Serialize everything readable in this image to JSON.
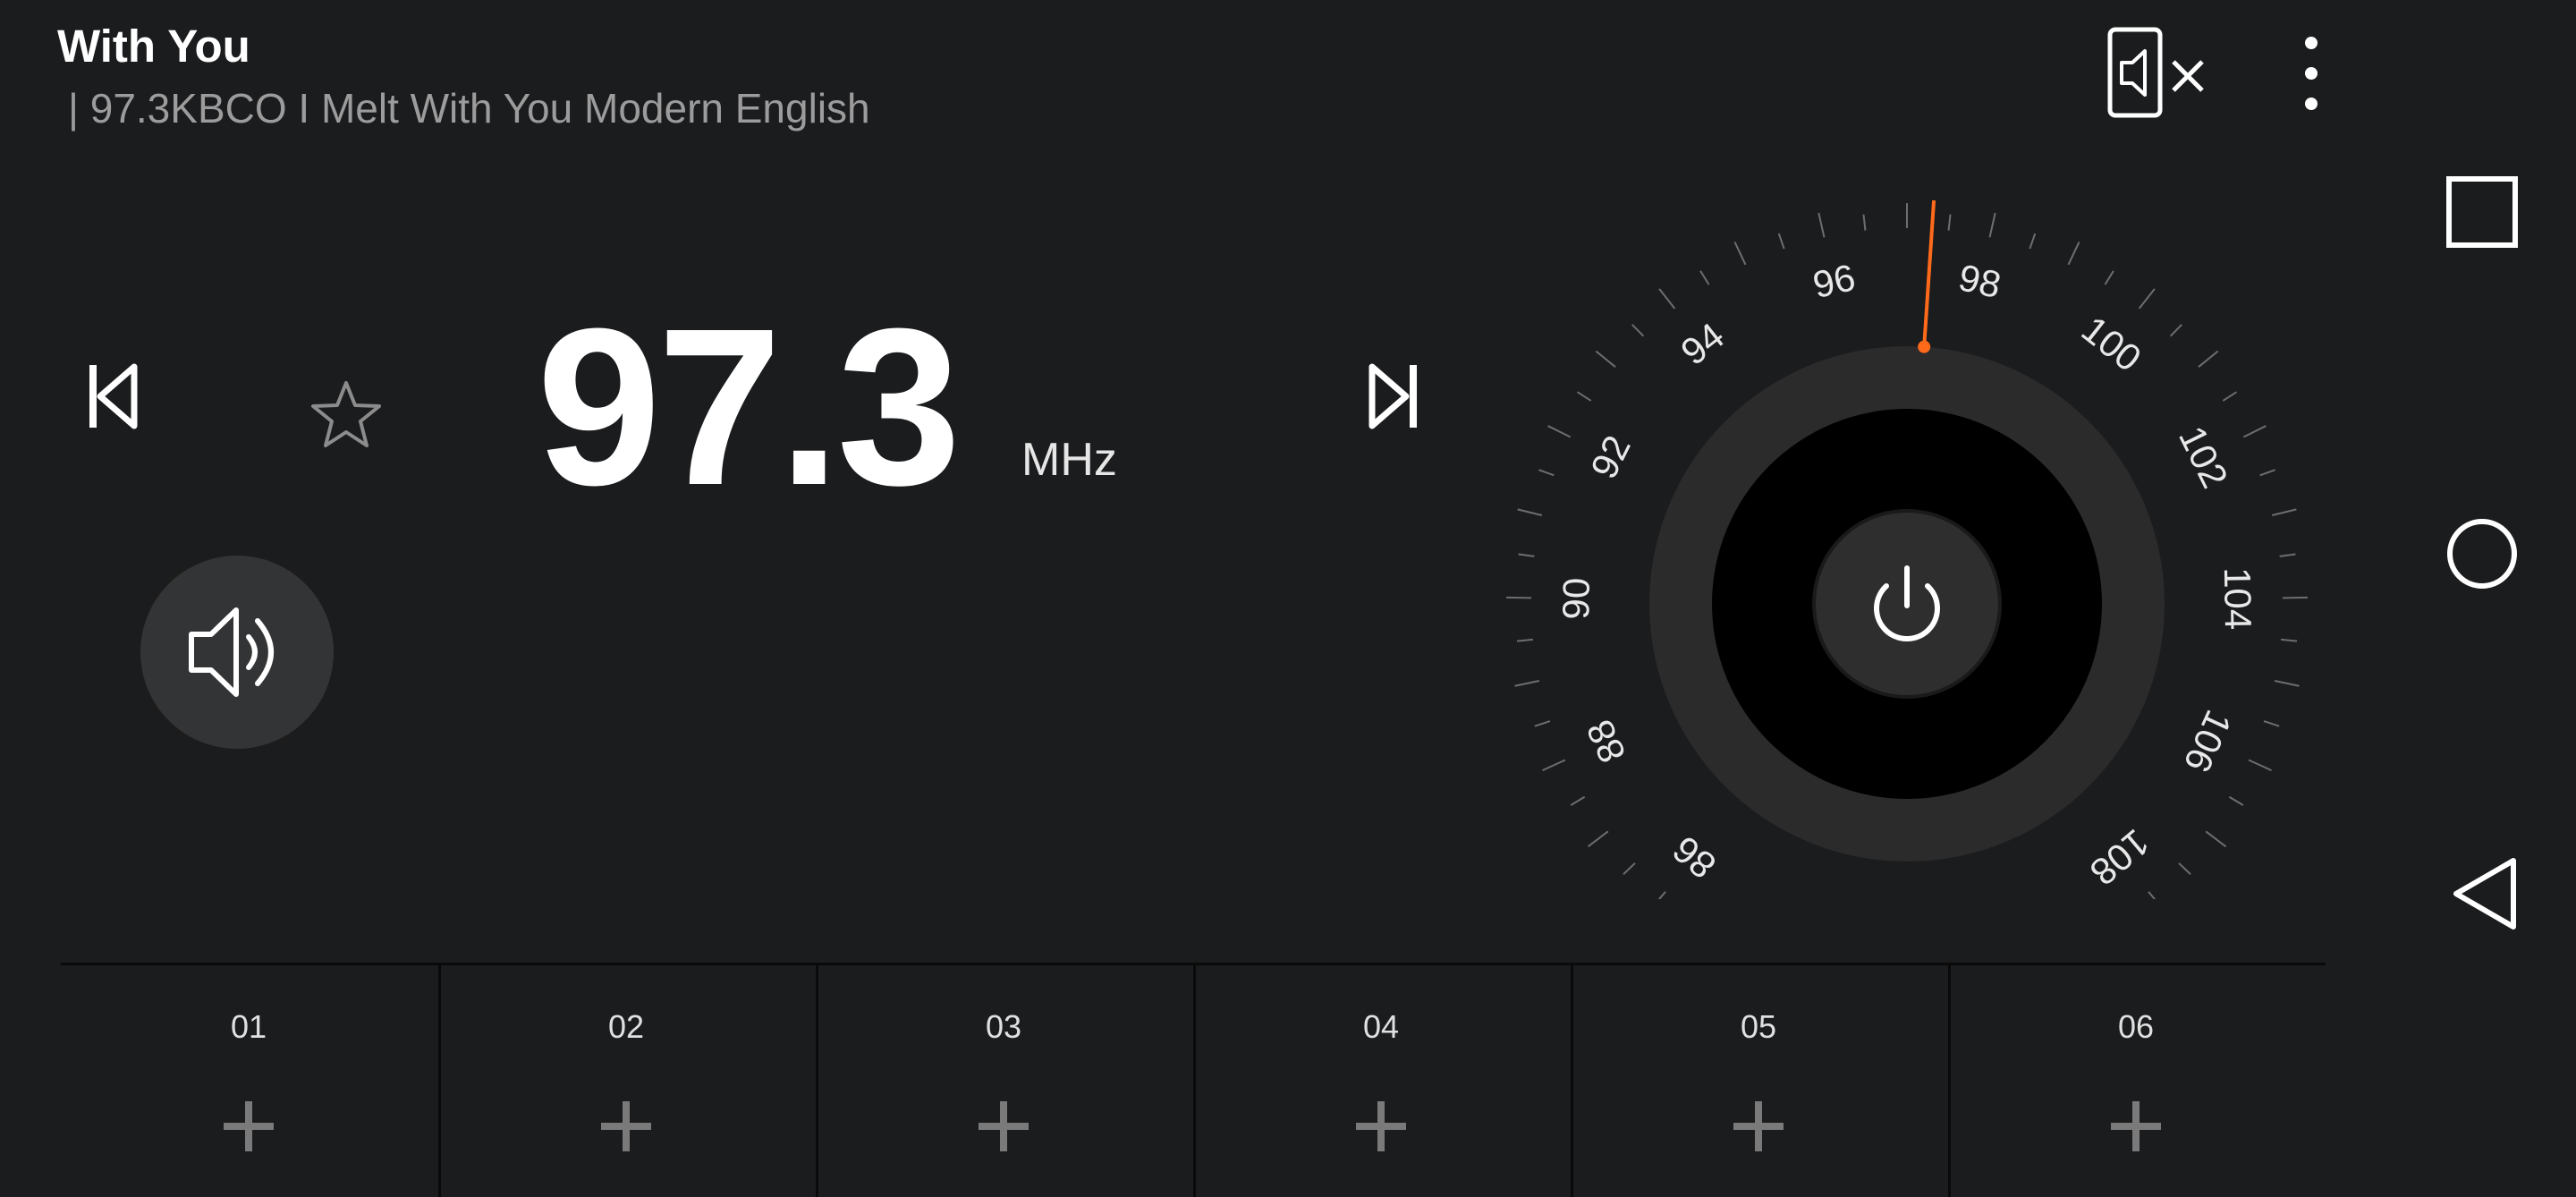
{
  "station": {
    "title": "With You",
    "rds": " | 97.3KBCO I Melt With You Modern English"
  },
  "tuner": {
    "frequency": "97.3",
    "unit": "MHz",
    "favorite": false
  },
  "dial": {
    "labels": [
      "86",
      "88",
      "90",
      "92",
      "94",
      "96",
      "98",
      "100",
      "102",
      "104",
      "106",
      "108"
    ],
    "needle_color": "#ff6a1a",
    "value": 97.3
  },
  "presets": [
    {
      "number": "01"
    },
    {
      "number": "02"
    },
    {
      "number": "03"
    },
    {
      "number": "04"
    },
    {
      "number": "05"
    },
    {
      "number": "06"
    }
  ],
  "colors": {
    "background": "#1b1c1e",
    "accent": "#ff6a1a",
    "muted_text": "#9c9c9c"
  }
}
